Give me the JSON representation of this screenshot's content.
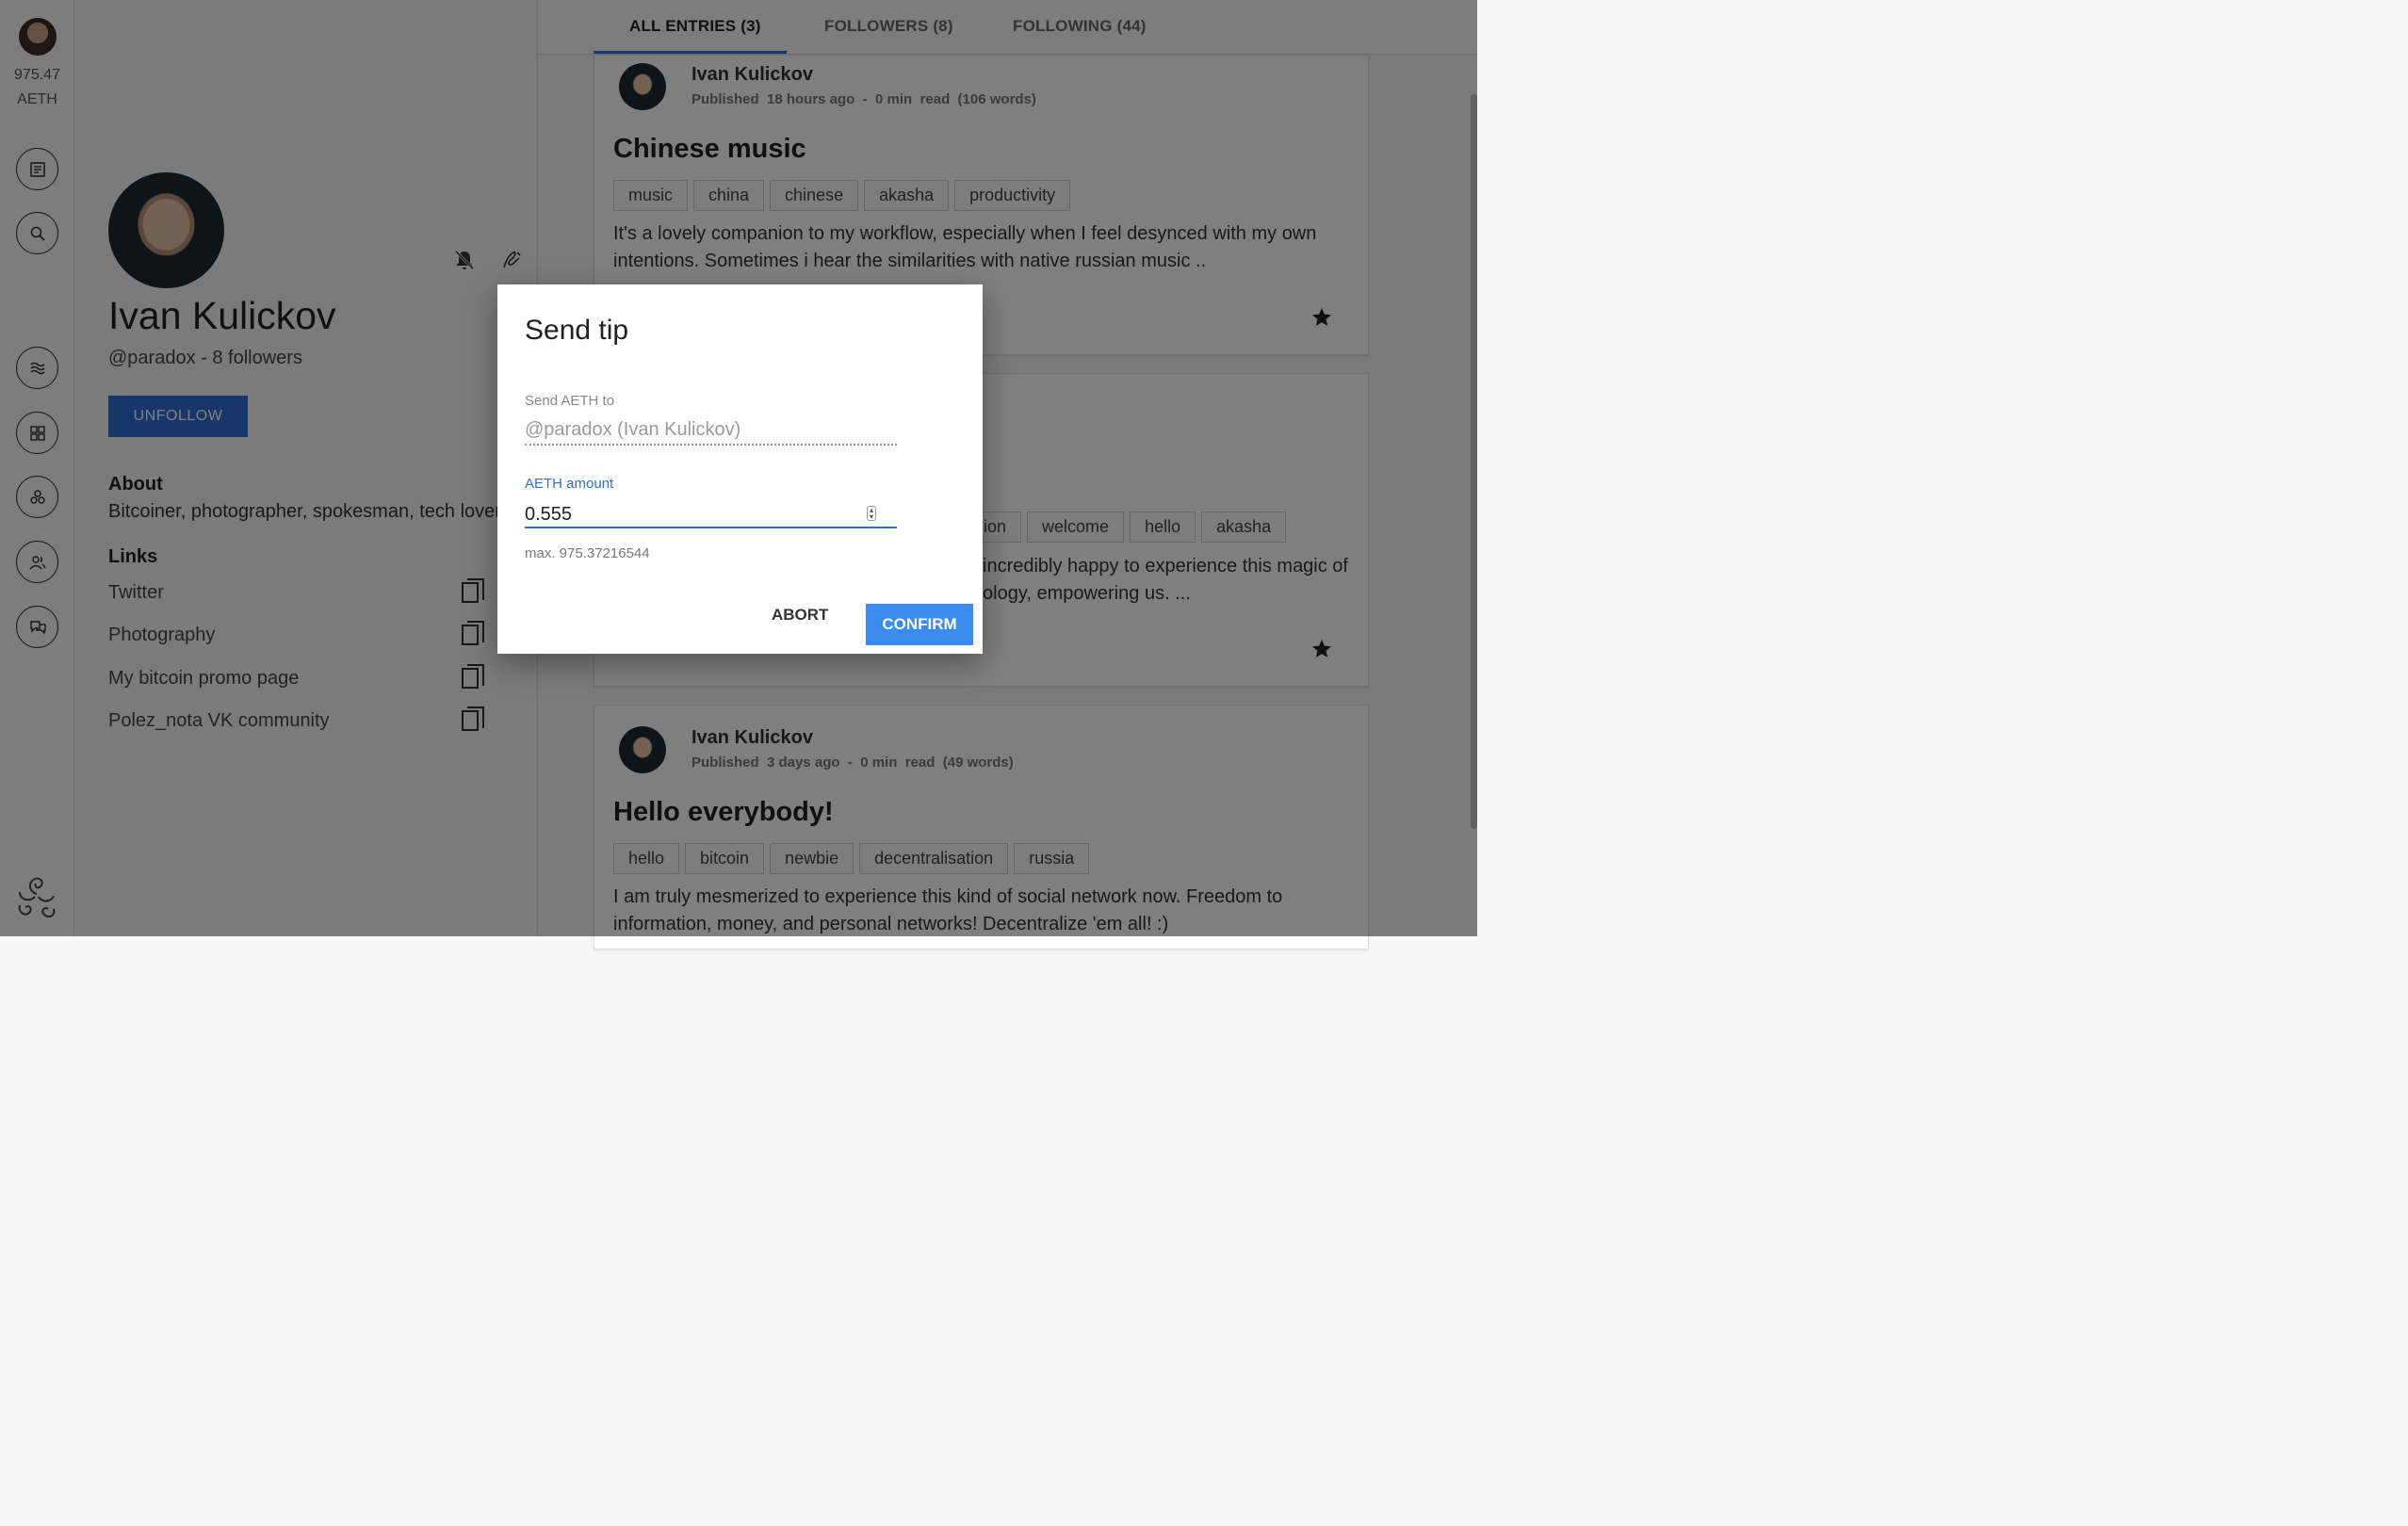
{
  "sidebar": {
    "balance_value": "975.47",
    "balance_unit": "AETH",
    "icons": [
      "entries-icon",
      "search-icon",
      "stream-icon",
      "dashboard-icon",
      "communities-icon",
      "people-icon",
      "chat-icon"
    ]
  },
  "profile": {
    "name": "Ivan Kulickov",
    "handle_line": "@paradox - 8 followers",
    "unfollow_label": "UNFOLLOW",
    "about_heading": "About",
    "about_text": "Bitcoiner, photographer, spokesman, tech lover.",
    "links_heading": "Links",
    "links": [
      "Twitter",
      "Photography",
      "My bitcoin promo page",
      "Polez_nota VK community"
    ]
  },
  "tabs": [
    {
      "label": "ALL ENTRIES (3)"
    },
    {
      "label": "FOLLOWERS (8)"
    },
    {
      "label": "FOLLOWING (44)"
    }
  ],
  "entries": [
    {
      "author": "Ivan Kulickov",
      "meta": "Published  18 hours ago  -  0 min  read  (106 words)",
      "title": "Chinese music",
      "tags": [
        "music",
        "china",
        "chinese",
        "akasha",
        "productivity"
      ],
      "body": "It's a lovely companion to my workflow, especially when I feel desynced with my own intentions. Sometimes i hear the similarities with native russian music .."
    },
    {
      "meta_visible": "s)",
      "tags_visible": [
        "ion",
        "welcome",
        "hello",
        "akasha"
      ],
      "body_line1": "incredibly happy to experience this magic of",
      "body_line2": "ology, empowering us. ..."
    },
    {
      "author": "Ivan Kulickov",
      "meta": "Published  3 days ago  -  0 min  read  (49 words)",
      "title": "Hello everybody!",
      "tags": [
        "hello",
        "bitcoin",
        "newbie",
        "decentralisation",
        "russia"
      ],
      "body": "I am truly mesmerized to experience this kind of social network now. Freedom to information, money, and personal networks! Decentralize 'em all! :)"
    }
  ],
  "dialog": {
    "title": "Send tip",
    "to_label": "Send AETH to",
    "to_value": "@paradox (Ivan Kulickov)",
    "amount_label": "AETH amount",
    "amount_value": "0.555",
    "max_text": "max. 975.37216544",
    "abort_label": "ABORT",
    "confirm_label": "CONFIRM"
  },
  "colors": {
    "accent": "#2f6fd6",
    "confirm": "#3b8cf0"
  }
}
